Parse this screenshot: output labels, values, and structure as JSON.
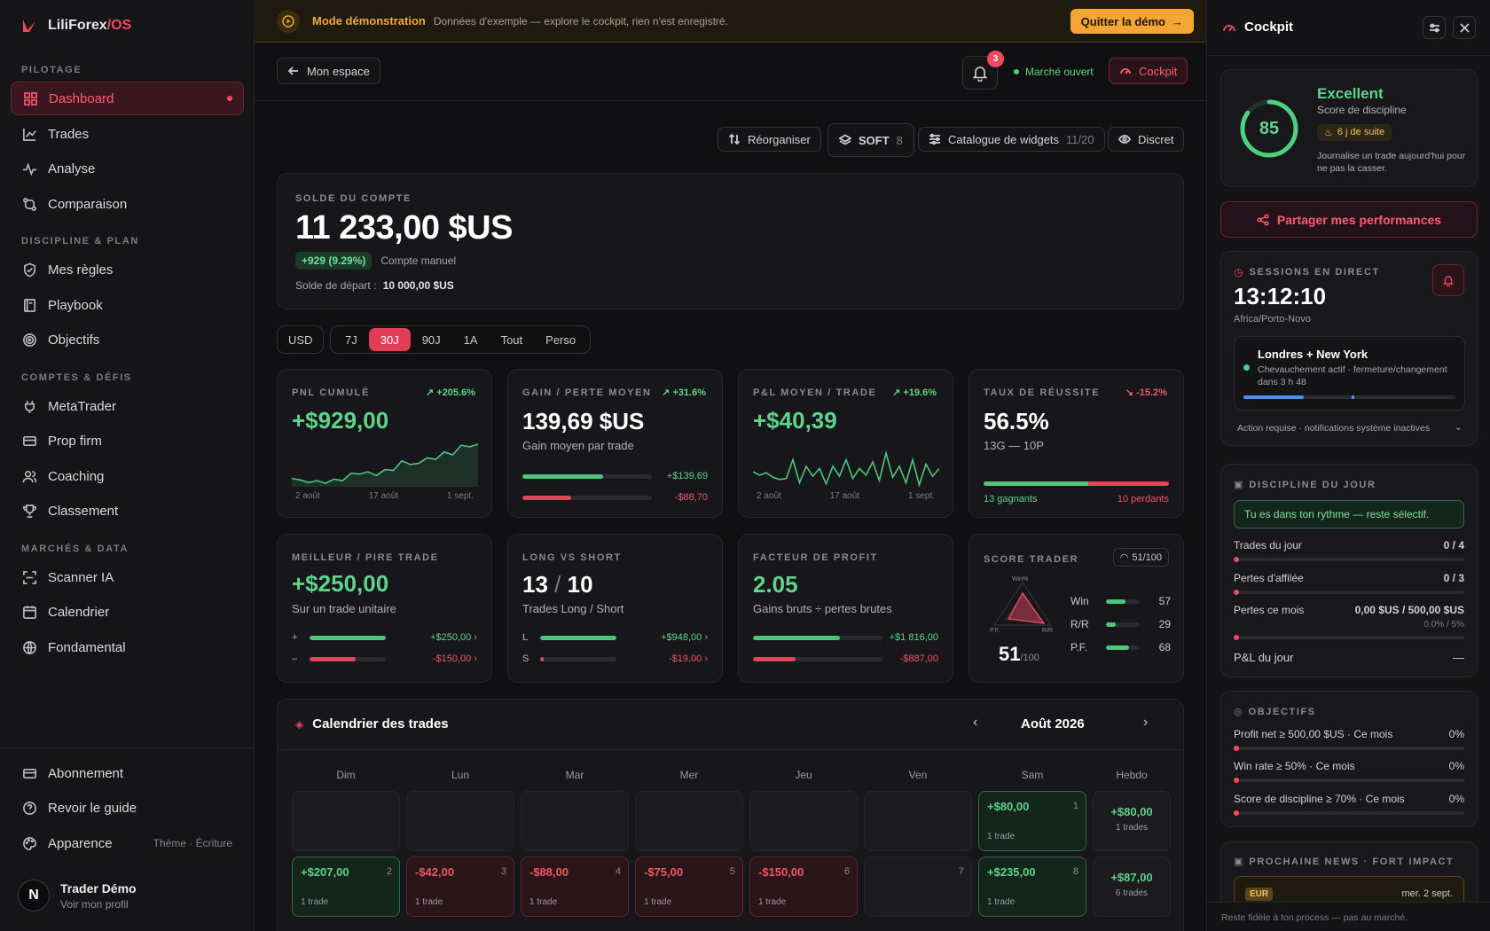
{
  "brand": {
    "name": "LiliForex",
    "suffix": "/OS"
  },
  "sidebar": {
    "sections": [
      "PILOTAGE",
      "DISCIPLINE & PLAN",
      "COMPTES & DÉFIS",
      "MARCHÉS & DATA"
    ],
    "items": [
      {
        "label": "Dashboard",
        "icon": "grid-icon"
      },
      {
        "label": "Trades",
        "icon": "chart-line-icon"
      },
      {
        "label": "Analyse",
        "icon": "pulse-icon"
      },
      {
        "label": "Comparaison",
        "icon": "compare-icon"
      },
      {
        "label": "Mes règles",
        "icon": "shield-icon"
      },
      {
        "label": "Playbook",
        "icon": "book-icon"
      },
      {
        "label": "Objectifs",
        "icon": "target-icon"
      },
      {
        "label": "MetaTrader",
        "icon": "plug-icon"
      },
      {
        "label": "Prop firm",
        "icon": "card-icon"
      },
      {
        "label": "Coaching",
        "icon": "users-icon"
      },
      {
        "label": "Classement",
        "icon": "trophy-icon"
      },
      {
        "label": "Scanner IA",
        "icon": "scan-icon"
      },
      {
        "label": "Calendrier",
        "icon": "calendar-icon"
      },
      {
        "label": "Fondamental",
        "icon": "globe-icon"
      }
    ],
    "bottom": [
      {
        "label": "Abonnement",
        "icon": "card-icon"
      },
      {
        "label": "Revoir le guide",
        "icon": "help-icon"
      },
      {
        "label": "Apparence",
        "icon": "palette-icon",
        "extra": "Thème · Écriture"
      }
    ],
    "user": {
      "initial": "N",
      "name": "Trader Démo",
      "sub": "Voir mon profil"
    }
  },
  "banner": {
    "title": "Mode démonstration",
    "desc": "Données d'exemple — explore le cockpit, rien n'est enregistré.",
    "quit": "Quitter la démo"
  },
  "header": {
    "back": "Mon espace",
    "notif_count": "3",
    "market": "Marché ouvert",
    "cockpit": "Cockpit"
  },
  "toolbar": {
    "reorganize": "Réorganiser",
    "mode": "SOFT",
    "mode_count": "8",
    "catalog": "Catalogue de widgets",
    "catalog_count": "11/20",
    "discreet": "Discret"
  },
  "balance": {
    "label": "SOLDE DU COMPTE",
    "value": "11 233,00 $US",
    "change": "+929 (9.29%)",
    "account": "Compte manuel",
    "start_label": "Solde de départ :",
    "start_value": "10 000,00 $US"
  },
  "currency": "USD",
  "periods": [
    "7J",
    "30J",
    "90J",
    "1A",
    "Tout",
    "Perso"
  ],
  "kpis": {
    "pnl": {
      "label": "PNL CUMULÉ",
      "change": "+205.6%",
      "value": "+$929,00",
      "dates": [
        "2 août",
        "17 août",
        "1 sept."
      ]
    },
    "avg": {
      "label": "GAIN / PERTE MOYEN",
      "change": "+31.6%",
      "value": "139,69 $US",
      "sub": "Gain moyen par trade",
      "gain": "+$139,69",
      "loss": "-$88,70",
      "gain_pct": 0.62,
      "loss_pct": 0.38
    },
    "pl_trade": {
      "label": "P&L MOYEN / TRADE",
      "change": "+19.6%",
      "value": "+$40,39",
      "dates": [
        "2 août",
        "17 août",
        "1 sept."
      ]
    },
    "winrate": {
      "label": "TAUX DE RÉUSSITE",
      "change": "-15.2%",
      "value": "56.5%",
      "sub": "13G — 10P",
      "winners": "13 gagnants",
      "losers": "10 perdants",
      "win_pct": 0.565
    },
    "best": {
      "label": "MEILLEUR / PIRE TRADE",
      "value": "+$250,00",
      "sub": "Sur un trade unitaire",
      "plus": "+",
      "minus": "–",
      "best": "+$250,00 ›",
      "worst": "-$150,00 ›",
      "best_pct": 1.0,
      "worst_pct": 0.6
    },
    "ls": {
      "label": "LONG VS SHORT",
      "long": "13",
      "sep": "/",
      "short": "10",
      "sub": "Trades Long / Short",
      "l": "L",
      "s": "S",
      "lv": "+$948,00 ›",
      "sv": "-$19,00 ›",
      "l_pct": 1.0,
      "s_pct": 0.05
    },
    "pf": {
      "label": "FACTEUR DE PROFIT",
      "value": "2.05",
      "sub": "Gains bruts ÷ pertes brutes",
      "gv": "+$1 816,00",
      "lv": "-$887,00",
      "g_pct": 0.67,
      "l_pct": 0.33
    },
    "score": {
      "label": "SCORE TRADER",
      "badge": "51/100",
      "value": "51",
      "of": "/100",
      "axes": [
        "Win%",
        "P.F.",
        "R/R"
      ],
      "rows": [
        {
          "k": "Win",
          "v": "57",
          "pct": 0.57
        },
        {
          "k": "R/R",
          "v": "29",
          "pct": 0.29
        },
        {
          "k": "P.F.",
          "v": "68",
          "pct": 0.68
        }
      ]
    }
  },
  "chart_data": [
    {
      "type": "area",
      "title": "PNL CUMULÉ",
      "x": [
        "2 août",
        "17 août",
        "1 sept."
      ],
      "values": [
        0,
        -40,
        -110,
        -60,
        -130,
        -20,
        -60,
        140,
        120,
        180,
        80,
        240,
        220,
        480,
        380,
        410,
        560,
        520,
        720,
        640,
        900,
        860,
        929
      ]
    },
    {
      "type": "line",
      "title": "P&L MOYEN / TRADE",
      "x": [
        "2 août",
        "17 août",
        "1 sept."
      ],
      "values": [
        10,
        -20,
        0,
        -40,
        -60,
        -50,
        120,
        -90,
        60,
        -30,
        40,
        -100,
        60,
        -30,
        120,
        -50,
        40,
        -20,
        100,
        -70,
        180,
        -40,
        60,
        -90,
        120,
        -110,
        80,
        -30,
        40
      ]
    }
  ],
  "calendar": {
    "title": "Calendrier des trades",
    "month": "Août 2026",
    "days": [
      "Dim",
      "Lun",
      "Mar",
      "Mer",
      "Jeu",
      "Ven",
      "Sam",
      "Hebdo"
    ],
    "week1": [
      {
        "v": "",
        "d": "",
        "t": "",
        "k": "empty"
      },
      {
        "v": "",
        "d": "",
        "t": "",
        "k": "empty"
      },
      {
        "v": "",
        "d": "",
        "t": "",
        "k": "empty"
      },
      {
        "v": "",
        "d": "",
        "t": "",
        "k": "empty"
      },
      {
        "v": "",
        "d": "",
        "t": "",
        "k": "empty"
      },
      {
        "v": "",
        "d": "",
        "t": "",
        "k": "empty"
      },
      {
        "v": "+$80,00",
        "d": "1",
        "t": "1 trade",
        "k": "win"
      }
    ],
    "week1_total": {
      "v": "+$80,00",
      "t": "1 trades"
    },
    "week2": [
      {
        "v": "+$207,00",
        "d": "2",
        "t": "1 trade",
        "k": "win"
      },
      {
        "v": "-$42,00",
        "d": "3",
        "t": "1 trade",
        "k": "loss"
      },
      {
        "v": "-$88,00",
        "d": "4",
        "t": "1 trade",
        "k": "loss"
      },
      {
        "v": "-$75,00",
        "d": "5",
        "t": "1 trade",
        "k": "loss"
      },
      {
        "v": "-$150,00",
        "d": "6",
        "t": "1 trade",
        "k": "loss"
      },
      {
        "v": "",
        "d": "7",
        "t": "",
        "k": "empty"
      },
      {
        "v": "+$235,00",
        "d": "8",
        "t": "1 trade",
        "k": "win"
      }
    ],
    "week2_total": {
      "v": "+$87,00",
      "t": "6 trades"
    }
  },
  "cockpit": {
    "title": "Cockpit",
    "score": {
      "value": "85",
      "rating": "Excellent",
      "label": "Score de discipline",
      "streak": "6 j de suite",
      "hint": "Journalise un trade aujourd'hui pour ne pas la casser.",
      "pct": 0.85
    },
    "share": "Partager mes performances",
    "sessions": {
      "label": "SESSIONS EN DIRECT",
      "time": "13:12:10",
      "tz": "Africa/Porto-Novo",
      "name": "Londres + New York",
      "desc": "Chevauchement actif · fermeture/changement dans 3 h 48",
      "action": "Action requise · notifications système inactives"
    },
    "discipline": {
      "label": "DISCIPLINE DU JOUR",
      "msg": "Tu es dans ton rythme — reste sélectif.",
      "rows": [
        {
          "k": "Trades du jour",
          "v": "0 / 4"
        },
        {
          "k": "Pertes d'affilée",
          "v": "0 / 3"
        },
        {
          "k": "Pertes ce mois",
          "v": "0,00 $US / 500,00 $US"
        }
      ],
      "pct_line": "0.0% / 5%",
      "pl_label": "P&L du jour",
      "pl_value": "—"
    },
    "goals": {
      "label": "OBJECTIFS",
      "rows": [
        {
          "k": "Profit net ≥ 500,00 $US · Ce mois",
          "v": "0%"
        },
        {
          "k": "Win rate ≥ 50% · Ce mois",
          "v": "0%"
        },
        {
          "k": "Score de discipline ≥ 70% · Ce mois",
          "v": "0%"
        }
      ]
    },
    "news": {
      "label": "PROCHAINE NEWS · FORT IMPACT",
      "currency": "EUR",
      "date": "mer. 2 sept."
    },
    "footer": "Reste fidèle à ton process — pas au marché."
  },
  "colors": {
    "accent": "#ef4b5f",
    "positive": "#5fd38a",
    "negative": "#f0566a",
    "warning": "#f5a534"
  }
}
